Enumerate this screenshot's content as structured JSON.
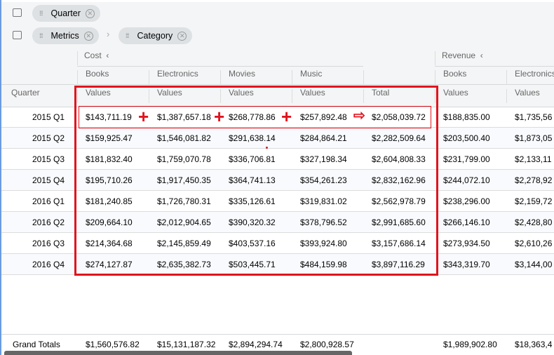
{
  "toolbar": {
    "rows_pill": "Quarter",
    "columns_pills": [
      "Metrics",
      "Category"
    ]
  },
  "header": {
    "metrics": [
      "Cost",
      "Revenue"
    ],
    "categories": [
      "Books",
      "Electronics",
      "Movies",
      "Music",
      "",
      "Books",
      "Electronics"
    ],
    "row_header": "Quarter",
    "value_labels": [
      "Values",
      "Values",
      "Values",
      "Values",
      "Total",
      "Values",
      "Values"
    ]
  },
  "rows": [
    {
      "quarter": "2015 Q1",
      "values": [
        "$143,711.19",
        "$1,387,657.18",
        "$268,778.86",
        "$257,892.48",
        "$2,058,039.72",
        "$188,835.00",
        "$1,735,56"
      ]
    },
    {
      "quarter": "2015 Q2",
      "values": [
        "$159,925.47",
        "$1,546,081.82",
        "$291,638.14",
        "$284,864.21",
        "$2,282,509.64",
        "$203,500.40",
        "$1,873,05"
      ]
    },
    {
      "quarter": "2015 Q3",
      "values": [
        "$181,832.40",
        "$1,759,070.78",
        "$336,706.81",
        "$327,198.34",
        "$2,604,808.33",
        "$231,799.00",
        "$2,133,11"
      ]
    },
    {
      "quarter": "2015 Q4",
      "values": [
        "$195,710.26",
        "$1,917,450.35",
        "$364,741.13",
        "$354,261.23",
        "$2,832,162.96",
        "$244,072.10",
        "$2,278,92"
      ]
    },
    {
      "quarter": "2016 Q1",
      "values": [
        "$181,240.85",
        "$1,726,780.31",
        "$335,126.61",
        "$319,831.02",
        "$2,562,978.79",
        "$238,296.00",
        "$2,159,72"
      ]
    },
    {
      "quarter": "2016 Q2",
      "values": [
        "$209,664.10",
        "$2,012,904.65",
        "$390,320.32",
        "$378,796.52",
        "$2,991,685.60",
        "$266,146.10",
        "$2,428,80"
      ]
    },
    {
      "quarter": "2016 Q3",
      "values": [
        "$214,364.68",
        "$2,145,859.49",
        "$403,537.16",
        "$393,924.80",
        "$3,157,686.14",
        "$273,934.50",
        "$2,610,26"
      ]
    },
    {
      "quarter": "2016 Q4",
      "values": [
        "$274,127.87",
        "$2,635,382.73",
        "$503,445.71",
        "$484,159.98",
        "$3,897,116.29",
        "$343,319.70",
        "$3,144,00"
      ]
    }
  ],
  "grand_totals": {
    "label": "Grand Totals",
    "values": [
      "$1,560,576.82",
      "$15,131,187.32",
      "$2,894,294.74",
      "$2,800,928.57",
      "",
      "$1,989,902.80",
      "$18,363,4"
    ]
  },
  "annotation_color": "#e0141e"
}
